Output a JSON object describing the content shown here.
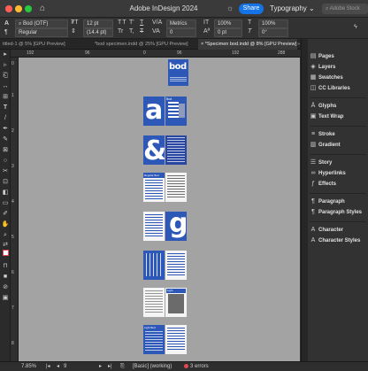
{
  "title_bar": {
    "app_title": "Adobe InDesign 2024",
    "share_label": "Share",
    "workspace_label": "Typography",
    "stock_search_placeholder": "Adobe Stock"
  },
  "control_bar": {
    "font_family": "Bod (OTF)",
    "font_style": "Regular",
    "font_size": "12 pt",
    "leading": "(14.4 pt)",
    "kerning": "Metrics",
    "vertical_scale": "100%",
    "horizontal_scale": "100%",
    "tracking": "0",
    "baseline_shift": "0 pt",
    "skew": "0°",
    "char_style_glyphs": [
      "TT",
      "T'",
      "T,",
      "Tr",
      "T",
      "T"
    ]
  },
  "doc_tabs": [
    {
      "label": "titled-1 @ 5% [GPU Preview]",
      "active": false
    },
    {
      "label": "*bod specimen.indd @ 25% [GPU Preview]",
      "active": false
    },
    {
      "label": "*Specimen bod.indd @ 8% [GPU Preview]",
      "active": true
    }
  ],
  "ruler": {
    "horizontal_ticks": [
      "192",
      "96",
      "0",
      "96",
      "192",
      "288"
    ],
    "vertical_ticks": [
      "0",
      "1",
      "2",
      "3",
      "4",
      "5",
      "6",
      "7",
      "8"
    ]
  },
  "pages": [
    {
      "kind": "cover",
      "text": "bod"
    },
    {
      "kind": "glyph-spread",
      "glyph": "a",
      "caption": "Bod"
    },
    {
      "kind": "glyph-spread",
      "glyph": "&"
    },
    {
      "kind": "text-spread",
      "caption": "Regular Bod"
    },
    {
      "kind": "glyph-spread-right",
      "glyph": "g"
    },
    {
      "kind": "text-spread-blue"
    },
    {
      "kind": "light-spread",
      "caption": "Light"
    },
    {
      "kind": "text-spread-last",
      "caption": "Light Bod"
    }
  ],
  "status_bar": {
    "zoom": "7.85%",
    "page_number": "9",
    "preflight_profile": "[Basic] (working)",
    "errors": "3 errors"
  },
  "right_panel": {
    "groups": [
      [
        "Pages",
        "Layers",
        "Swatches",
        "CC Libraries"
      ],
      [
        "Glyphs",
        "Text Wrap"
      ],
      [
        "Stroke",
        "Gradient"
      ],
      [
        "Story",
        "Hyperlinks",
        "Effects"
      ],
      [
        "Paragraph",
        "Paragraph Styles"
      ],
      [
        "Character",
        "Character Styles"
      ]
    ],
    "icons": {
      "Pages": "pages-icon",
      "Layers": "layers-icon",
      "Swatches": "swatches-icon",
      "CC Libraries": "cc-libraries-icon",
      "Glyphs": "glyphs-icon",
      "Text Wrap": "text-wrap-icon",
      "Stroke": "stroke-icon",
      "Gradient": "gradient-icon",
      "Story": "story-icon",
      "Hyperlinks": "hyperlinks-icon",
      "Effects": "effects-icon",
      "Paragraph": "paragraph-icon",
      "Paragraph Styles": "paragraph-styles-icon",
      "Character": "character-icon",
      "Character Styles": "character-styles-icon"
    }
  },
  "colors": {
    "brand_blue": "#2e58b8",
    "share_blue": "#1473e6",
    "pasteboard": "#a3a3a3",
    "error_red": "#e34850"
  }
}
